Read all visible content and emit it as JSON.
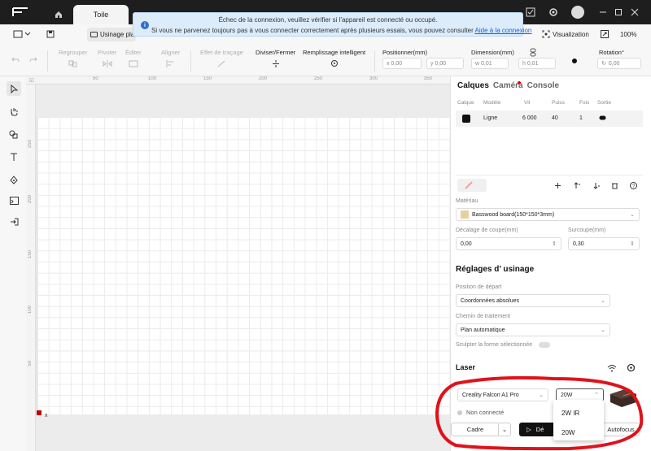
{
  "titlebar": {
    "doc_tab": "Toile"
  },
  "toolbar1": {
    "mode_label": "Usinage pla",
    "visualize_label": "Visualization",
    "zoom": "100%"
  },
  "notification": {
    "line1": "Échec de la connexion, veuillez vérifier si l'appareil est connecté ou occupé.",
    "line2": "Si vous ne parvenez toujours pas à vous connecter correctement après plusieurs essais, vous pouvez consulter",
    "link": "Aide à la connexion"
  },
  "toolbar2": {
    "group": "Regrouper",
    "flip": "Pivoter",
    "edit": "Éditer",
    "align": "Aligner",
    "offset": "Effet de traçage",
    "divide": "Diviser/Fermer",
    "fill": "Remplissage intelligent",
    "position_label": "Positionner(mm)",
    "x": "x 0,00",
    "y": "y 0,00",
    "dimension_label": "Dimension(mm)",
    "w": "w 0,01",
    "h": "h 0,01",
    "rotation_label": "Rotation°",
    "rotation": "0,00"
  },
  "rulers": {
    "top": [
      "0",
      "50",
      "100",
      "150",
      "200",
      "250",
      "300",
      "350"
    ],
    "left": [
      "50",
      "100",
      "150",
      "200",
      "250",
      "300",
      "350"
    ]
  },
  "canvas": {
    "origin_label": "x"
  },
  "panel": {
    "tabs": [
      "Calques",
      "Caméra",
      "Console"
    ],
    "layer_headers": [
      "Calque",
      "Modèle",
      "Vit",
      "Puiss",
      "Fois",
      "Sortie"
    ],
    "layer": {
      "mode": "Ligne",
      "speed": "6 000",
      "power": "40",
      "passes": "1"
    },
    "material_label": "Matériau",
    "material": "Basswood board(150*150*3mm)",
    "offset_label": "Décalage de coupe(mm)",
    "offset": "0,00",
    "kerf_label": "Surcoupe(mm)",
    "kerf": "0,30",
    "settings_title": "Réglages d’ usinage",
    "start_label": "Position de départ",
    "start": "Coordonnées absolues",
    "path_label": "Chemin de traitement",
    "path": "Plan automatique",
    "sculpt_label": "Sculpter la forme sélectionnée",
    "laser_title": "Laser",
    "machine": "Creality Falcon A1 Pro",
    "power_selected": "20W",
    "status": "Non connecté",
    "frame_btn": "Cadre",
    "start_btn": "Dé",
    "autofocus_btn": "Autofocus"
  },
  "power_options": [
    "2W IR",
    "20W"
  ]
}
